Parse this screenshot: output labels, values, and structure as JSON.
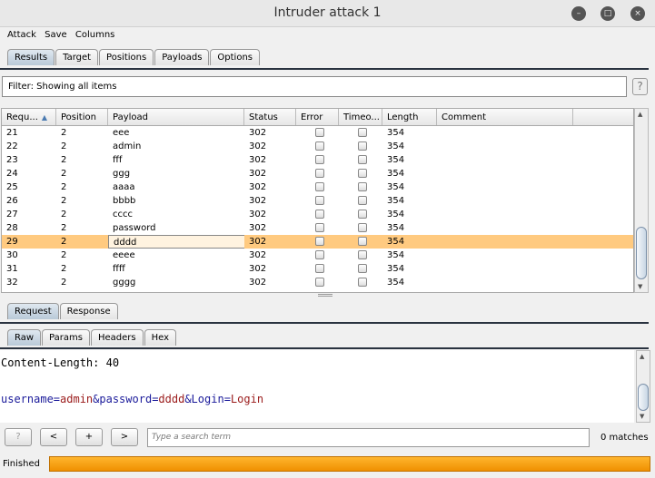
{
  "window": {
    "title": "Intruder attack 1"
  },
  "menu": [
    "Attack",
    "Save",
    "Columns"
  ],
  "main_tabs": [
    "Results",
    "Target",
    "Positions",
    "Payloads",
    "Options"
  ],
  "filter": {
    "text": "Filter: Showing all items",
    "help": "?"
  },
  "table": {
    "columns": [
      "Requ...",
      "Position",
      "Payload",
      "Status",
      "Error",
      "Timeo...",
      "Length",
      "Comment"
    ],
    "sort_indicator": "▲",
    "rows": [
      [
        "21",
        "2",
        "eee",
        "302",
        "",
        "",
        "354",
        ""
      ],
      [
        "22",
        "2",
        "admin",
        "302",
        "",
        "",
        "354",
        ""
      ],
      [
        "23",
        "2",
        "fff",
        "302",
        "",
        "",
        "354",
        ""
      ],
      [
        "24",
        "2",
        "ggg",
        "302",
        "",
        "",
        "354",
        ""
      ],
      [
        "25",
        "2",
        "aaaa",
        "302",
        "",
        "",
        "354",
        ""
      ],
      [
        "26",
        "2",
        "bbbb",
        "302",
        "",
        "",
        "354",
        ""
      ],
      [
        "27",
        "2",
        "cccc",
        "302",
        "",
        "",
        "354",
        ""
      ],
      [
        "28",
        "2",
        "password",
        "302",
        "",
        "",
        "354",
        ""
      ],
      [
        "29",
        "2",
        "dddd",
        "302",
        "",
        "",
        "354",
        ""
      ],
      [
        "30",
        "2",
        "eeee",
        "302",
        "",
        "",
        "354",
        ""
      ],
      [
        "31",
        "2",
        "ffff",
        "302",
        "",
        "",
        "354",
        ""
      ],
      [
        "32",
        "2",
        "gggg",
        "302",
        "",
        "",
        "354",
        ""
      ]
    ],
    "selected_request": "29"
  },
  "req_tabs": [
    "Request",
    "Response"
  ],
  "view_tabs": [
    "Raw",
    "Params",
    "Headers",
    "Hex"
  ],
  "editor": {
    "line1_key": "Content-Length:",
    "line1_val": " 40",
    "body": [
      [
        "username",
        "k"
      ],
      [
        "=",
        "k"
      ],
      [
        "admin",
        "v"
      ],
      [
        "&password",
        "k"
      ],
      [
        "=",
        "k"
      ],
      [
        "dddd",
        "v"
      ],
      [
        "&Login",
        "k"
      ],
      [
        "=",
        "k"
      ],
      [
        "Login",
        "v"
      ]
    ]
  },
  "search": {
    "buttons": [
      "?",
      "<",
      "+",
      ">"
    ],
    "placeholder": "Type a search term",
    "matches": "0 matches"
  },
  "status": {
    "text": "Finished",
    "progress_percent": 100
  },
  "colors": {
    "selected_row": "#ffca80",
    "progress": "#f5a01a",
    "key": "#1a1a9a",
    "value": "#9a1a1a"
  }
}
